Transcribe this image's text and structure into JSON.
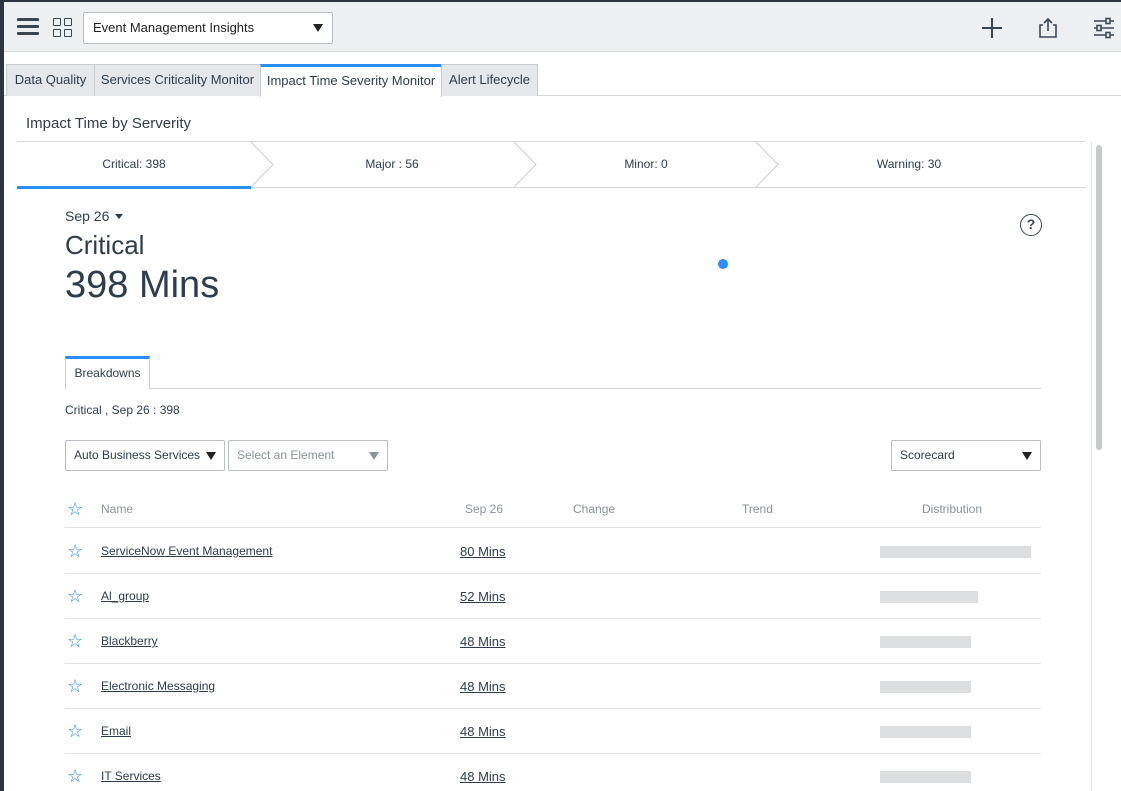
{
  "toolbar": {
    "dashboard_selected": "Event Management Insights"
  },
  "tabs": [
    {
      "label": "Data Quality",
      "active": false
    },
    {
      "label": "Services Criticality Monitor",
      "active": false
    },
    {
      "label": "Impact Time Severity Monitor",
      "active": true
    },
    {
      "label": "Alert Lifecycle",
      "active": false
    }
  ],
  "widget": {
    "title": "Impact Time by Serverity",
    "severity_steps": [
      {
        "label": "Critical: 398",
        "active": true
      },
      {
        "label": "Major : 56",
        "active": false
      },
      {
        "label": "Minor: 0",
        "active": false
      },
      {
        "label": "Warning: 30",
        "active": false
      }
    ],
    "date": "Sep 26",
    "severity_label": "Critical",
    "severity_value": "398 Mins",
    "breakdown_tab": "Breakdowns",
    "breakdown_caption": "Critical , Sep 26 : 398",
    "filters": {
      "breakdown_select": "Auto Business Services",
      "element_select_placeholder": "Select an Element",
      "view_select": "Scorecard"
    },
    "table": {
      "headers": {
        "name": "Name",
        "date": "Sep 26",
        "change": "Change",
        "trend": "Trend",
        "distribution": "Distribution"
      },
      "rows": [
        {
          "name": "ServiceNow Event Management",
          "value": "80 Mins",
          "distribution": 80
        },
        {
          "name": "Al_group",
          "value": "52 Mins",
          "distribution": 52
        },
        {
          "name": "Blackberry",
          "value": "48 Mins",
          "distribution": 48
        },
        {
          "name": "Electronic Messaging",
          "value": "48 Mins",
          "distribution": 48
        },
        {
          "name": "Email",
          "value": "48 Mins",
          "distribution": 48
        },
        {
          "name": "IT Services",
          "value": "48 Mins",
          "distribution": 48
        }
      ]
    }
  },
  "colors": {
    "accent": "#278efc",
    "text": "#2e3d4d",
    "bar": "#dcdedf"
  }
}
